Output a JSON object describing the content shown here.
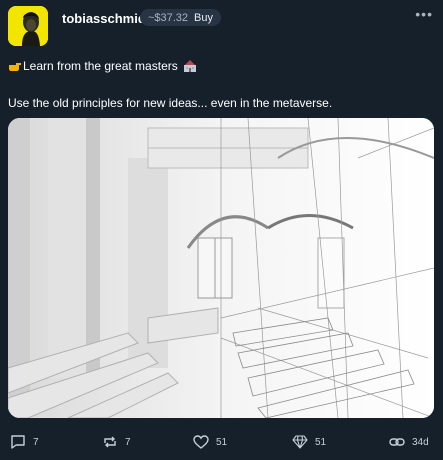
{
  "post": {
    "author": {
      "username": "tobiasschmid"
    },
    "price_pill": {
      "price": "~$37.32",
      "buy_label": "Buy"
    },
    "more_label": "•••",
    "text": {
      "line1": "Learn from the great masters",
      "line2": "Use the old principles for new ideas... even in the metaverse."
    },
    "media": {
      "description_icon": "cathedral-render"
    },
    "actions": {
      "comments": "7",
      "reposts": "7",
      "likes": "51",
      "diamonds": "51",
      "age": "34d"
    }
  },
  "colors": {
    "background": "#15202b",
    "pill": "#273444",
    "icon": "#c7d0d8",
    "avatar_yellow": "#f2e600"
  }
}
